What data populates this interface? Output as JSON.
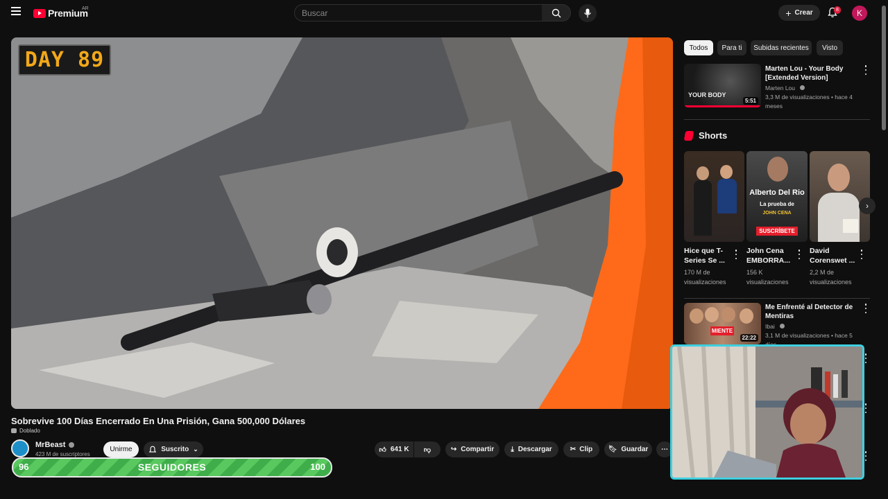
{
  "header": {
    "logo_text": "Premium",
    "region": "AR",
    "search_placeholder": "Buscar",
    "create_label": "Crear",
    "notification_count": "8",
    "avatar_letter": "K"
  },
  "player": {
    "overlay_text": "DAY 89"
  },
  "video": {
    "title": "Sobrevive 100 Días Encerrado En Una Prisión, Gana 500,000 Dólares",
    "dubbed_label": "Doblado",
    "channel_name": "MrBeast",
    "subscribers": "423 M de suscriptores",
    "join_label": "Unirme",
    "subscribed_label": "Suscrito",
    "actions": {
      "likes": "641 K",
      "share": "Compartir",
      "download": "Descargar",
      "clip": "Clip",
      "save": "Guardar"
    }
  },
  "followers_bar": {
    "current": "96",
    "label": "SEGUIDORES",
    "goal": "100",
    "progress_percent": 96
  },
  "sidebar": {
    "chips": [
      "Todos",
      "Para ti",
      "Subidas recientes",
      "Visto"
    ],
    "active_chip": "Todos",
    "videos": [
      {
        "title_line1": "Marten Lou - Your Body",
        "title_line2": "[Extended Version]",
        "channel": "Marten Lou",
        "meta": "3,3 M de visualizaciones • hace 4 meses",
        "duration": "5:51",
        "thumb_text": "YOUR BODY"
      },
      {
        "title_line1": "Me Enfrenté al Detector de",
        "title_line2": "Mentiras",
        "channel": "Ibai",
        "meta": "3,1 M de visualizaciones • hace 5 días",
        "duration": "22:22",
        "thumb_text": "MIENTE"
      }
    ],
    "shorts_title": "Shorts",
    "shorts": [
      {
        "title_line1": "Hice que T-",
        "title_line2": "Series Se ...",
        "views_line1": "170 M de",
        "views_line2": "visualizaciones"
      },
      {
        "title_line1": "John Cena",
        "title_line2": "EMBORRA...",
        "views_line1": "156 K",
        "views_line2": "visualizaciones",
        "thumb_line1": "Alberto Del Rio",
        "thumb_line2": "La prueba de",
        "thumb_line3": "JOHN CENA",
        "thumb_badge": "SUSCRÍBETE"
      },
      {
        "title_line1": "David",
        "title_line2": "Corenswet ...",
        "views_line1": "2,2 M de",
        "views_line2": "visualizaciones"
      }
    ]
  },
  "colors": {
    "background": "#0f0f0f",
    "brand_red": "#ff0033",
    "followers_green": "#59c95f",
    "webcam_border": "#3dd0e0",
    "day_badge_text": "#f2a818"
  }
}
